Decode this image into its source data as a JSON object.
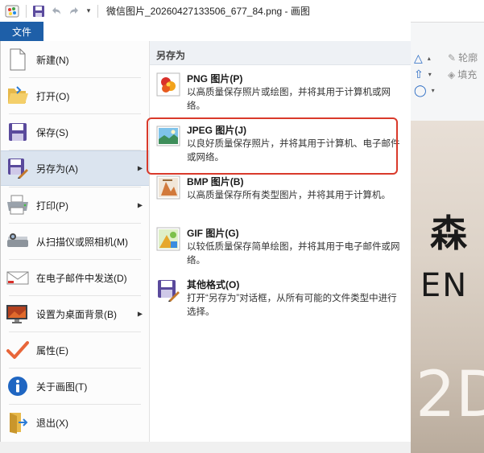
{
  "titlebar": {
    "title": "微信图片_20260427133506_677_84.png - 画图",
    "icons": [
      "paint-app-icon",
      "save-icon",
      "undo-icon",
      "redo-icon",
      "customize-qat-icon"
    ]
  },
  "file_tab": {
    "label": "文件"
  },
  "ribbon": {
    "outline_label": "轮廓",
    "fill_label": "填充"
  },
  "canvas": {
    "visible_chars": [
      "森",
      "EN",
      "2D"
    ]
  },
  "menu": {
    "items": [
      {
        "label": "新建(N)",
        "icon": "new-document-icon",
        "has_submenu": false
      },
      {
        "label": "打开(O)",
        "icon": "open-folder-icon",
        "has_submenu": false
      },
      {
        "label": "保存(S)",
        "icon": "save-icon",
        "has_submenu": false
      },
      {
        "label": "另存为(A)",
        "icon": "save-as-icon",
        "has_submenu": true,
        "selected": true
      },
      {
        "label": "打印(P)",
        "icon": "printer-icon",
        "has_submenu": true
      },
      {
        "label": "从扫描仪或照相机(M)",
        "icon": "scanner-icon",
        "has_submenu": false
      },
      {
        "label": "在电子邮件中发送(D)",
        "icon": "email-icon",
        "has_submenu": false
      },
      {
        "label": "设置为桌面背景(B)",
        "icon": "desktop-background-icon",
        "has_submenu": true
      },
      {
        "label": "属性(E)",
        "icon": "checkmark-icon",
        "has_submenu": false
      },
      {
        "label": "关于画图(T)",
        "icon": "info-icon",
        "has_submenu": false
      },
      {
        "label": "退出(X)",
        "icon": "exit-icon",
        "has_submenu": false
      }
    ]
  },
  "saveas": {
    "header": "另存为",
    "options": [
      {
        "title": "PNG 图片(P)",
        "desc": "以高质量保存照片或绘图，并将其用于计算机或网络。",
        "icon": "png-image-icon"
      },
      {
        "title": "JPEG 图片(J)",
        "desc": "以良好质量保存照片，并将其用于计算机、电子邮件或网络。",
        "icon": "jpeg-image-icon",
        "highlighted": true
      },
      {
        "title": "BMP 图片(B)",
        "desc": "以高质量保存所有类型图片，并将其用于计算机。",
        "icon": "bmp-image-icon"
      },
      {
        "title": "GIF 图片(G)",
        "desc": "以较低质量保存简单绘图，并将其用于电子邮件或网络。",
        "icon": "gif-image-icon"
      },
      {
        "title": "其他格式(O)",
        "desc": "打开“另存为”对话框，从所有可能的文件类型中进行选择。",
        "icon": "other-formats-icon"
      }
    ]
  },
  "colors": {
    "file_tab_bg": "#1e5fa8",
    "selected_item_bg": "#dbe4ef",
    "highlight_border": "#d93a2b"
  }
}
